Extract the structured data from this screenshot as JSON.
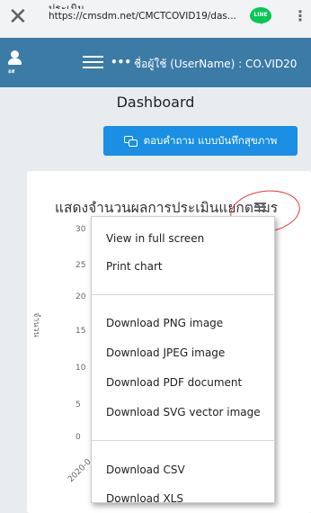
{
  "browser": {
    "site_title": "ประเมิน",
    "url": "https://cmsdm.net/CMCTCOVID19/das...",
    "line_label": "LINE"
  },
  "navbar": {
    "avatar_label": "อส",
    "dots": "•••",
    "user_text": "ชื่อผู้ใช้ (UserName) : CO.VID20"
  },
  "page": {
    "title": "Dashboard",
    "survey_button": "ตอบคำถาม แบบบันทึกสุขภาพ"
  },
  "chart": {
    "title": "แสดงจำนวนผลการประเมินแยกตามร",
    "y_axis_title": "จำนวน",
    "y_ticks": [
      "30",
      "25",
      "20",
      "15",
      "10",
      "5",
      "0"
    ],
    "x_tick": "2020-0"
  },
  "export_menu": {
    "items": [
      "View in full screen",
      "Print chart",
      "Download PNG image",
      "Download JPEG image",
      "Download PDF document",
      "Download SVG vector image",
      "Download CSV",
      "Download XLS"
    ]
  },
  "colors": {
    "navbar": "#3c7ba6",
    "button": "#1a8fe3",
    "highlight_circle": "#e23b3b"
  }
}
